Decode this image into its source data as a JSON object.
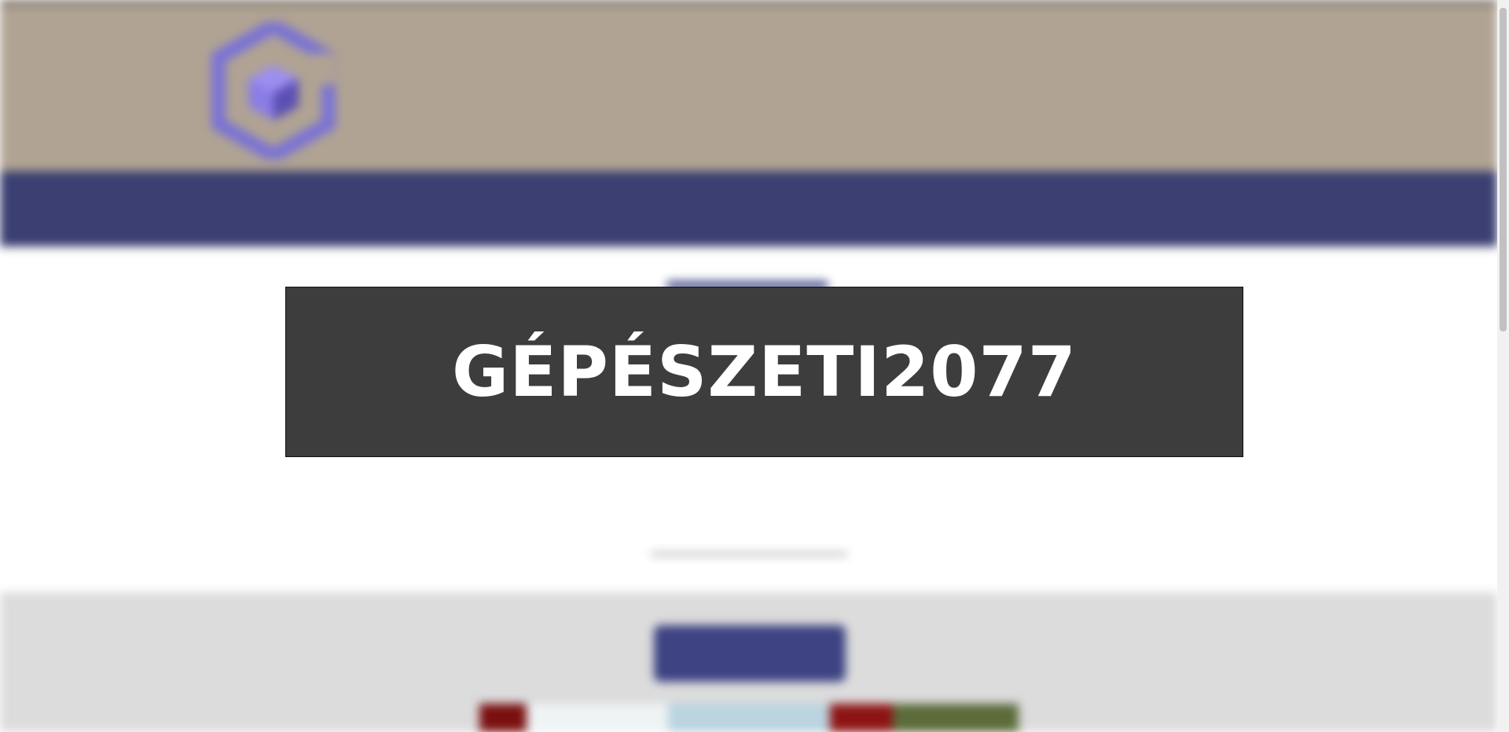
{
  "header": {
    "tagline_small": "",
    "site_title": "",
    "site_subtitle": ""
  },
  "nav": {
    "items": [
      "",
      "",
      "",
      ""
    ]
  },
  "main": {
    "intro_text": "",
    "gallery_button": ""
  },
  "overlay": {
    "title": "GÉPÉSZETI2077"
  },
  "colors": {
    "header_bg": "#b0a393",
    "nav_bg": "#3b3f72",
    "accent": "#3d4383",
    "overlay_bg": "#3d3d3d",
    "overlay_text": "#ffffff"
  },
  "icons": {
    "logo": "cube-hexagon-logo"
  }
}
